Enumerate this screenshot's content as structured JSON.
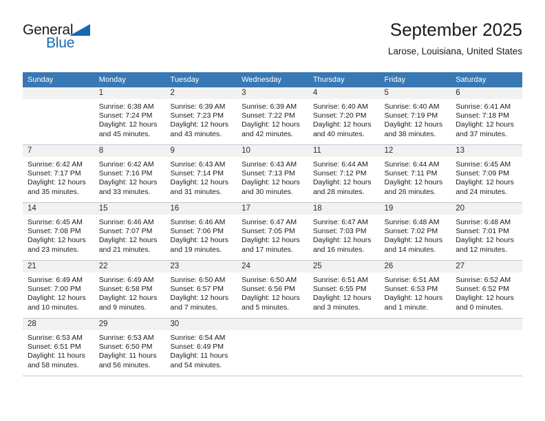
{
  "brand": {
    "word_one": "General",
    "word_two": "Blue",
    "flag_icon": "triangle-flag-icon",
    "accent_color": "#1668b3"
  },
  "header": {
    "title": "September 2025",
    "location": "Larose, Louisiana, United States"
  },
  "theme": {
    "header_row_bg": "#3878b4",
    "header_row_text": "#ffffff",
    "daynum_band_bg": "#f1f1f1",
    "cell_border": "#b9c8d8",
    "cell_bg": "#ffffff",
    "text_color": "#1a1a1a"
  },
  "calendar": {
    "weekday_headers": [
      "Sunday",
      "Monday",
      "Tuesday",
      "Wednesday",
      "Thursday",
      "Friday",
      "Saturday"
    ],
    "weeks": [
      [
        {
          "day": "",
          "sunrise": "",
          "sunset": "",
          "daylight_line1": "",
          "daylight_line2": "",
          "empty": true
        },
        {
          "day": "1",
          "sunrise": "Sunrise: 6:38 AM",
          "sunset": "Sunset: 7:24 PM",
          "daylight_line1": "Daylight: 12 hours",
          "daylight_line2": "and 45 minutes."
        },
        {
          "day": "2",
          "sunrise": "Sunrise: 6:39 AM",
          "sunset": "Sunset: 7:23 PM",
          "daylight_line1": "Daylight: 12 hours",
          "daylight_line2": "and 43 minutes."
        },
        {
          "day": "3",
          "sunrise": "Sunrise: 6:39 AM",
          "sunset": "Sunset: 7:22 PM",
          "daylight_line1": "Daylight: 12 hours",
          "daylight_line2": "and 42 minutes."
        },
        {
          "day": "4",
          "sunrise": "Sunrise: 6:40 AM",
          "sunset": "Sunset: 7:20 PM",
          "daylight_line1": "Daylight: 12 hours",
          "daylight_line2": "and 40 minutes."
        },
        {
          "day": "5",
          "sunrise": "Sunrise: 6:40 AM",
          "sunset": "Sunset: 7:19 PM",
          "daylight_line1": "Daylight: 12 hours",
          "daylight_line2": "and 38 minutes."
        },
        {
          "day": "6",
          "sunrise": "Sunrise: 6:41 AM",
          "sunset": "Sunset: 7:18 PM",
          "daylight_line1": "Daylight: 12 hours",
          "daylight_line2": "and 37 minutes."
        }
      ],
      [
        {
          "day": "7",
          "sunrise": "Sunrise: 6:42 AM",
          "sunset": "Sunset: 7:17 PM",
          "daylight_line1": "Daylight: 12 hours",
          "daylight_line2": "and 35 minutes."
        },
        {
          "day": "8",
          "sunrise": "Sunrise: 6:42 AM",
          "sunset": "Sunset: 7:16 PM",
          "daylight_line1": "Daylight: 12 hours",
          "daylight_line2": "and 33 minutes."
        },
        {
          "day": "9",
          "sunrise": "Sunrise: 6:43 AM",
          "sunset": "Sunset: 7:14 PM",
          "daylight_line1": "Daylight: 12 hours",
          "daylight_line2": "and 31 minutes."
        },
        {
          "day": "10",
          "sunrise": "Sunrise: 6:43 AM",
          "sunset": "Sunset: 7:13 PM",
          "daylight_line1": "Daylight: 12 hours",
          "daylight_line2": "and 30 minutes."
        },
        {
          "day": "11",
          "sunrise": "Sunrise: 6:44 AM",
          "sunset": "Sunset: 7:12 PM",
          "daylight_line1": "Daylight: 12 hours",
          "daylight_line2": "and 28 minutes."
        },
        {
          "day": "12",
          "sunrise": "Sunrise: 6:44 AM",
          "sunset": "Sunset: 7:11 PM",
          "daylight_line1": "Daylight: 12 hours",
          "daylight_line2": "and 26 minutes."
        },
        {
          "day": "13",
          "sunrise": "Sunrise: 6:45 AM",
          "sunset": "Sunset: 7:09 PM",
          "daylight_line1": "Daylight: 12 hours",
          "daylight_line2": "and 24 minutes."
        }
      ],
      [
        {
          "day": "14",
          "sunrise": "Sunrise: 6:45 AM",
          "sunset": "Sunset: 7:08 PM",
          "daylight_line1": "Daylight: 12 hours",
          "daylight_line2": "and 23 minutes."
        },
        {
          "day": "15",
          "sunrise": "Sunrise: 6:46 AM",
          "sunset": "Sunset: 7:07 PM",
          "daylight_line1": "Daylight: 12 hours",
          "daylight_line2": "and 21 minutes."
        },
        {
          "day": "16",
          "sunrise": "Sunrise: 6:46 AM",
          "sunset": "Sunset: 7:06 PM",
          "daylight_line1": "Daylight: 12 hours",
          "daylight_line2": "and 19 minutes."
        },
        {
          "day": "17",
          "sunrise": "Sunrise: 6:47 AM",
          "sunset": "Sunset: 7:05 PM",
          "daylight_line1": "Daylight: 12 hours",
          "daylight_line2": "and 17 minutes."
        },
        {
          "day": "18",
          "sunrise": "Sunrise: 6:47 AM",
          "sunset": "Sunset: 7:03 PM",
          "daylight_line1": "Daylight: 12 hours",
          "daylight_line2": "and 16 minutes."
        },
        {
          "day": "19",
          "sunrise": "Sunrise: 6:48 AM",
          "sunset": "Sunset: 7:02 PM",
          "daylight_line1": "Daylight: 12 hours",
          "daylight_line2": "and 14 minutes."
        },
        {
          "day": "20",
          "sunrise": "Sunrise: 6:48 AM",
          "sunset": "Sunset: 7:01 PM",
          "daylight_line1": "Daylight: 12 hours",
          "daylight_line2": "and 12 minutes."
        }
      ],
      [
        {
          "day": "21",
          "sunrise": "Sunrise: 6:49 AM",
          "sunset": "Sunset: 7:00 PM",
          "daylight_line1": "Daylight: 12 hours",
          "daylight_line2": "and 10 minutes."
        },
        {
          "day": "22",
          "sunrise": "Sunrise: 6:49 AM",
          "sunset": "Sunset: 6:58 PM",
          "daylight_line1": "Daylight: 12 hours",
          "daylight_line2": "and 9 minutes."
        },
        {
          "day": "23",
          "sunrise": "Sunrise: 6:50 AM",
          "sunset": "Sunset: 6:57 PM",
          "daylight_line1": "Daylight: 12 hours",
          "daylight_line2": "and 7 minutes."
        },
        {
          "day": "24",
          "sunrise": "Sunrise: 6:50 AM",
          "sunset": "Sunset: 6:56 PM",
          "daylight_line1": "Daylight: 12 hours",
          "daylight_line2": "and 5 minutes."
        },
        {
          "day": "25",
          "sunrise": "Sunrise: 6:51 AM",
          "sunset": "Sunset: 6:55 PM",
          "daylight_line1": "Daylight: 12 hours",
          "daylight_line2": "and 3 minutes."
        },
        {
          "day": "26",
          "sunrise": "Sunrise: 6:51 AM",
          "sunset": "Sunset: 6:53 PM",
          "daylight_line1": "Daylight: 12 hours",
          "daylight_line2": "and 1 minute."
        },
        {
          "day": "27",
          "sunrise": "Sunrise: 6:52 AM",
          "sunset": "Sunset: 6:52 PM",
          "daylight_line1": "Daylight: 12 hours",
          "daylight_line2": "and 0 minutes."
        }
      ],
      [
        {
          "day": "28",
          "sunrise": "Sunrise: 6:53 AM",
          "sunset": "Sunset: 6:51 PM",
          "daylight_line1": "Daylight: 11 hours",
          "daylight_line2": "and 58 minutes."
        },
        {
          "day": "29",
          "sunrise": "Sunrise: 6:53 AM",
          "sunset": "Sunset: 6:50 PM",
          "daylight_line1": "Daylight: 11 hours",
          "daylight_line2": "and 56 minutes."
        },
        {
          "day": "30",
          "sunrise": "Sunrise: 6:54 AM",
          "sunset": "Sunset: 6:49 PM",
          "daylight_line1": "Daylight: 11 hours",
          "daylight_line2": "and 54 minutes."
        },
        {
          "day": "",
          "sunrise": "",
          "sunset": "",
          "daylight_line1": "",
          "daylight_line2": "",
          "empty": true
        },
        {
          "day": "",
          "sunrise": "",
          "sunset": "",
          "daylight_line1": "",
          "daylight_line2": "",
          "empty": true
        },
        {
          "day": "",
          "sunrise": "",
          "sunset": "",
          "daylight_line1": "",
          "daylight_line2": "",
          "empty": true
        },
        {
          "day": "",
          "sunrise": "",
          "sunset": "",
          "daylight_line1": "",
          "daylight_line2": "",
          "empty": true
        }
      ]
    ]
  }
}
